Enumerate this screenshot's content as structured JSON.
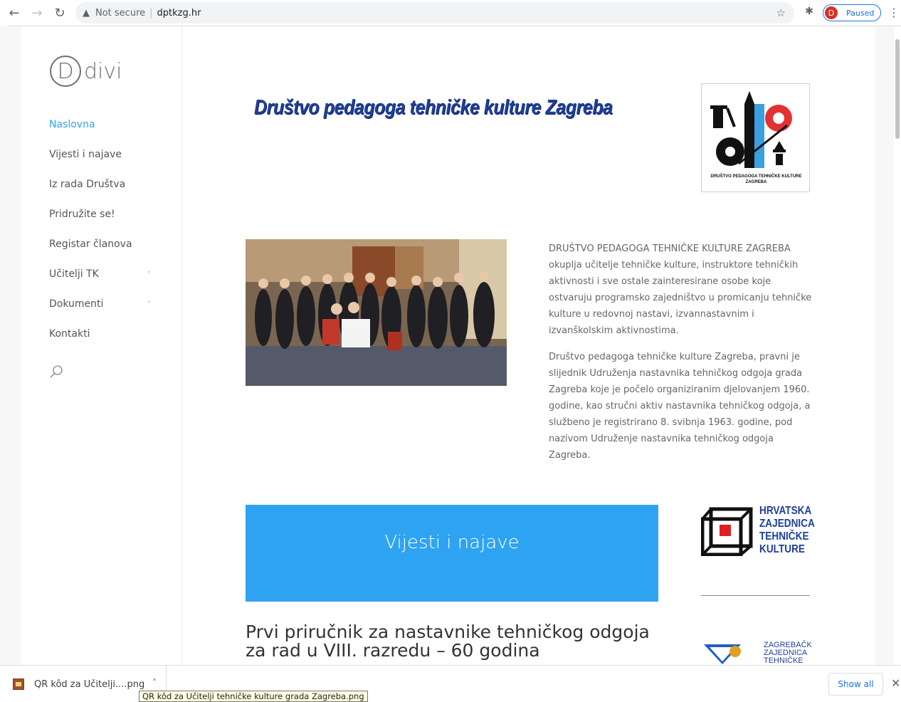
{
  "browser": {
    "back_icon": "←",
    "forward_icon": "→",
    "reload_icon": "↻",
    "security_icon": "▲",
    "security_text": "Not secure",
    "separator": "|",
    "url": "dptkzg.hr",
    "bookmark_icon": "☆",
    "extensions_icon": "✱",
    "profile_initial": "D",
    "profile_status": "Paused",
    "menu_icon": "⋮"
  },
  "sidebar": {
    "logo_letter": "D",
    "logo_text": "divi",
    "nav": [
      {
        "label": "Naslovna",
        "active": true,
        "has_submenu": false
      },
      {
        "label": "Vijesti i najave",
        "active": false,
        "has_submenu": false
      },
      {
        "label": "Iz rada Društva",
        "active": false,
        "has_submenu": false
      },
      {
        "label": "Pridružite se!",
        "active": false,
        "has_submenu": false
      },
      {
        "label": "Registar članova",
        "active": false,
        "has_submenu": false
      },
      {
        "label": "Učitelji TK",
        "active": false,
        "has_submenu": true,
        "caret": "˅"
      },
      {
        "label": "Dokumenti",
        "active": false,
        "has_submenu": true,
        "caret": "˅"
      },
      {
        "label": "Kontakti",
        "active": false,
        "has_submenu": false
      }
    ]
  },
  "main": {
    "banner_title": "Društvo pedagoga tehničke kulture Zagreba",
    "logo_caption": "DRUŠTVO PEDAGOGA TEHNIČKE KULTURE ZAGREBA",
    "intro_p1": "DRUŠTVO PEDAGOGA TEHNIČKE KULTURE ZAGREBA okuplja učitelje tehničke kulture, instruktore tehničkih aktivnosti i sve ostale zainteresirane osobe koje ostvaruju programsko zajedništvo u promicanju tehničke kulture u redovnoj nastavi, izvannastavnim i izvanškolskim aktivnostima.",
    "intro_p2": "Društvo pedagoga tehničke kulture Zagreba, pravni je slijednik Udruženja nastavnika tehničkog odgoja grada Zagreba koje je počelo organiziranim djelovanjem 1960. godine, kao stručni aktiv  nastavnika tehničkog odgoja, a  službeno je registrirano 8. svibnja 1963. godine, pod nazivom Udruženje nastavnika tehničkog odgoja Zagreba.",
    "news_button": "Vijesti i najave",
    "post_title_line1": "Prvi priručnik za nastavnike tehničkog odgoja",
    "post_title_line2": "za rad u VIII. razredu – 60 godina",
    "hztk_lines": [
      "HRVATSKA",
      "ZAJEDNICA",
      "TEHNIČKE",
      "KULTURE"
    ],
    "zztk_lines": [
      "ZAGREBAČKA",
      "ZAJEDNICA",
      "TEHNIČKE"
    ]
  },
  "downloads": {
    "item_name": "QR kôd za Učitelji....png",
    "arrow_icon": "˄",
    "tooltip": "QR kôd za Učitelji tehničke kulture grada Zagreba.png",
    "show_all": "Show all",
    "close_icon": "✕"
  },
  "colors": {
    "accent": "#2ea3f2",
    "banner_blue": "#1f3f9a",
    "logo_red": "#e53030"
  }
}
